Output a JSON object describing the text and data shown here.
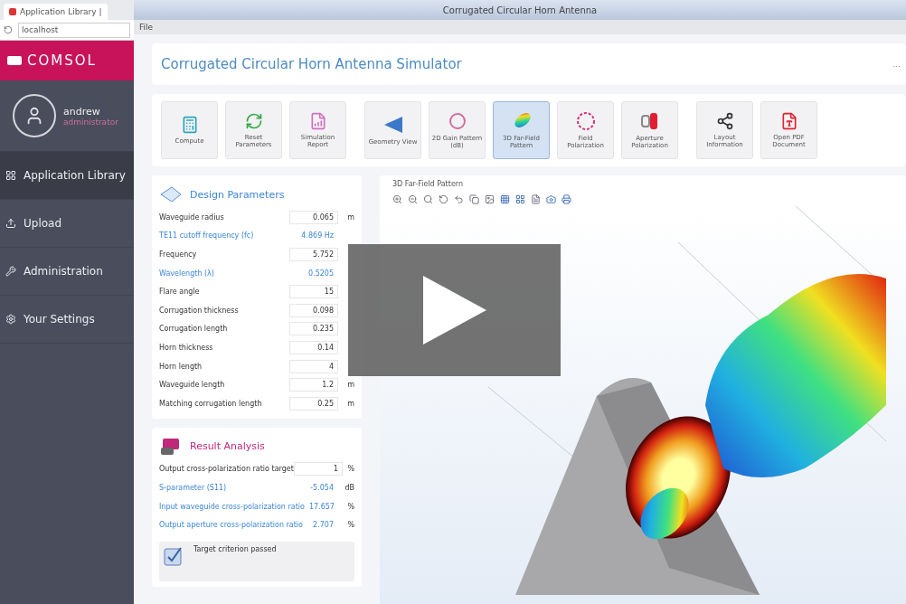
{
  "browser": {
    "tab_title": "Application Library |",
    "address": "localhost"
  },
  "sidebar": {
    "logo": "COMSOL",
    "user": {
      "name": "andrew",
      "role": "administrator"
    },
    "items": [
      {
        "label": "Application Library",
        "kind": "grid",
        "selected": true
      },
      {
        "label": "Upload",
        "kind": "upload",
        "selected": false
      },
      {
        "label": "Administration",
        "kind": "wrench",
        "selected": false
      },
      {
        "label": "Your Settings",
        "kind": "gear",
        "selected": false
      }
    ]
  },
  "window": {
    "title": "Corrugated Circular Horn Antenna",
    "menu": [
      "File"
    ]
  },
  "app": {
    "title": "Corrugated Circular Horn Antenna Simulator",
    "more": "..."
  },
  "toolbar": [
    [
      {
        "label": "Compute",
        "kind": "compute",
        "selected": false
      },
      {
        "label": "Reset Parameters",
        "kind": "reset",
        "selected": false
      },
      {
        "label": "Simulation Report",
        "kind": "report",
        "selected": false
      }
    ],
    [
      {
        "label": "Geometry View",
        "kind": "geometry",
        "selected": false
      },
      {
        "label": "2D Gain Pattern (dB)",
        "kind": "gain",
        "selected": false
      },
      {
        "label": "3D Far-Field Pattern",
        "kind": "farfield",
        "selected": true
      },
      {
        "label": "Field Polarization",
        "kind": "field",
        "selected": false
      },
      {
        "label": "Aperture Polarization",
        "kind": "aperture",
        "selected": false
      }
    ],
    [
      {
        "label": "Layout Information",
        "kind": "layout",
        "selected": false
      },
      {
        "label": "Open PDF Document",
        "kind": "pdf",
        "selected": false
      }
    ]
  ],
  "design": {
    "title": "Design Parameters",
    "rows": [
      {
        "label": "Waveguide radius",
        "value": "0.065",
        "unit": "m",
        "kind": "input"
      },
      {
        "label": "TE11 cutoff frequency (fc)",
        "value": "4.869 Hz",
        "kind": "output"
      },
      {
        "label": "Frequency",
        "value": "5.752",
        "kind": "input"
      },
      {
        "label": "Wavelength (λ)",
        "value": "0.5205",
        "kind": "output"
      },
      {
        "label": "Flare angle",
        "value": "15",
        "kind": "input"
      },
      {
        "label": "Corrugation thickness",
        "value": "0.098",
        "kind": "input"
      },
      {
        "label": "Corrugation length",
        "value": "0.235",
        "kind": "input"
      },
      {
        "label": "Horn thickness",
        "value": "0.14",
        "kind": "input"
      },
      {
        "label": "Horn length",
        "value": "4",
        "kind": "input"
      },
      {
        "label": "Waveguide length",
        "value": "1.2",
        "unit": "m",
        "kind": "input"
      },
      {
        "label": "Matching corrugation length",
        "value": "0.25",
        "unit": "m",
        "kind": "input"
      }
    ]
  },
  "results": {
    "title": "Result Analysis",
    "rows": [
      {
        "label": "Output cross-polarization ratio target",
        "value": "1",
        "unit": "%",
        "kind": "input"
      },
      {
        "label": "S-parameter (S11)",
        "value": "-5.054",
        "unit": "dB",
        "kind": "output"
      },
      {
        "label": "Input waveguide cross-polarization ratio",
        "value": "17.657",
        "unit": "%",
        "kind": "output"
      },
      {
        "label": "Output aperture cross-polarization ratio",
        "value": "2.707",
        "unit": "%",
        "kind": "output"
      }
    ],
    "status": "Target criterion passed"
  },
  "graphics": {
    "title": "3D Far-Field Pattern"
  }
}
